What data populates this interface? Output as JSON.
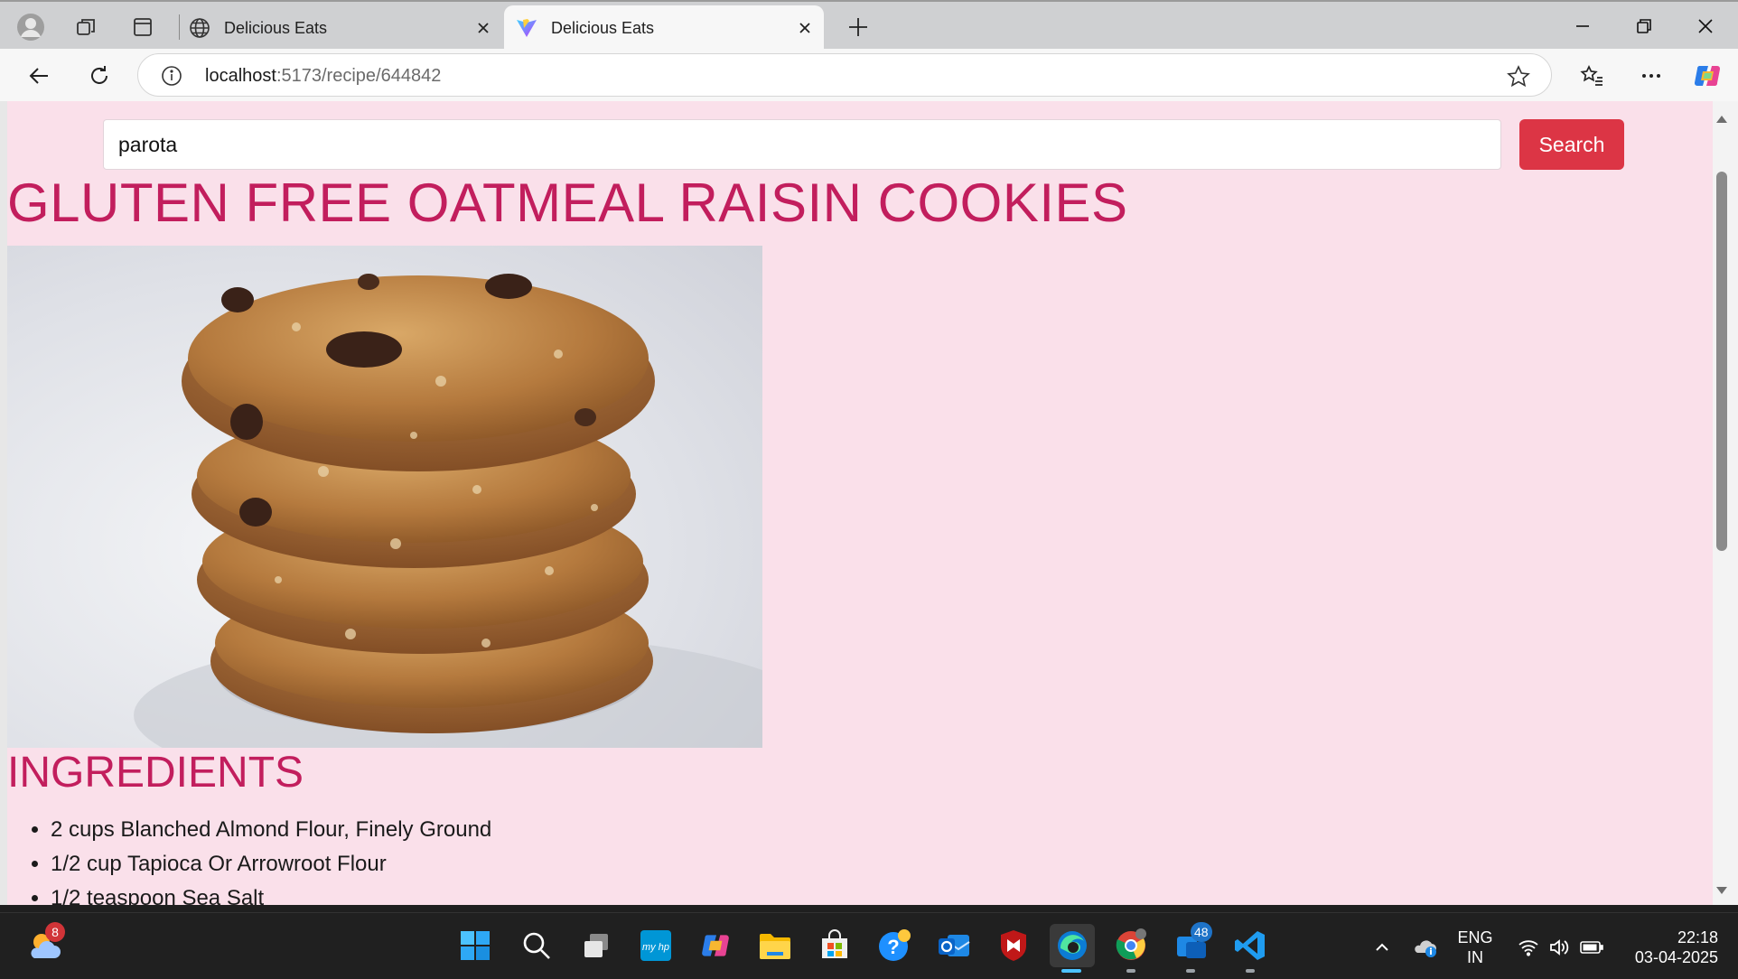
{
  "browser": {
    "tabs": [
      {
        "title": "Delicious Eats",
        "active": false
      },
      {
        "title": "Delicious Eats",
        "active": true
      }
    ],
    "url": {
      "host": "localhost",
      "path": ":5173/recipe/644842"
    }
  },
  "page": {
    "search": {
      "value": "parota",
      "button_label": "Search"
    },
    "recipe_title": "GLUTEN FREE OATMEAL RAISIN COOKIES",
    "ingredients_heading": "INGREDIENTS",
    "ingredients": [
      "2 cups Blanched Almond Flour, Finely Ground",
      "1/2 cup Tapioca Or Arrowroot Flour",
      "1/2 teaspoon Sea Salt"
    ],
    "colors": {
      "background": "#fae0ea",
      "heading": "#c21e5d",
      "search_button": "#dc3545"
    }
  },
  "taskbar": {
    "weather_badge": "8",
    "teams_badge": "48",
    "lang": {
      "line1": "ENG",
      "line2": "IN"
    },
    "clock": {
      "time": "22:18",
      "date": "03-04-2025"
    }
  }
}
